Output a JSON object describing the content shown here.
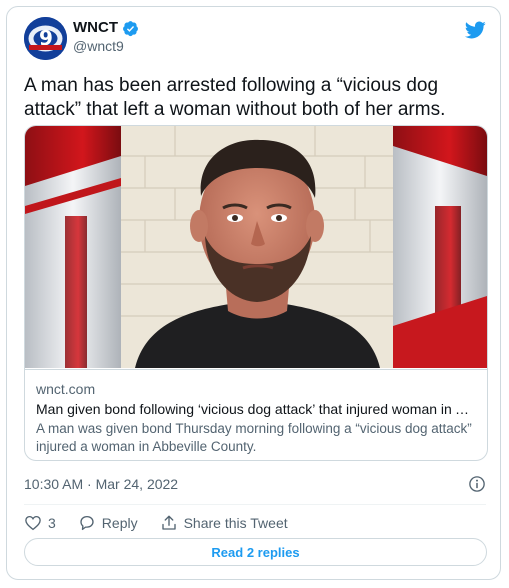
{
  "author": {
    "name": "WNCT",
    "handle": "@wnct9",
    "verified": true,
    "avatar_text": "9",
    "avatar_subtext": "WNCT"
  },
  "tweet": {
    "text": "A man has been arrested following a “vicious dog attack” that left a woman without both of her arms."
  },
  "link_card": {
    "domain": "wnct.com",
    "title": "Man given bond following ‘vicious dog attack’ that injured woman in Ab...",
    "description": "A man was given bond Thursday morning following a “vicious dog attack” injured a woman in Abbeville County."
  },
  "meta": {
    "timestamp": "10:30 AM · Mar 24, 2022"
  },
  "actions": {
    "like_count": "3",
    "reply_label": "Reply",
    "share_label": "Share this Tweet"
  },
  "replies_button": {
    "label": "Read 2 replies"
  },
  "colors": {
    "twitter_blue": "#1d9bf0",
    "verified": "#1d9bf0",
    "muted_text": "#536471",
    "border": "#cfd9de"
  },
  "icons": {
    "brand": "twitter-bird-icon",
    "verified": "verified-badge-icon",
    "info": "info-icon",
    "like": "heart-icon",
    "reply": "speech-bubble-icon",
    "share": "share-icon"
  }
}
